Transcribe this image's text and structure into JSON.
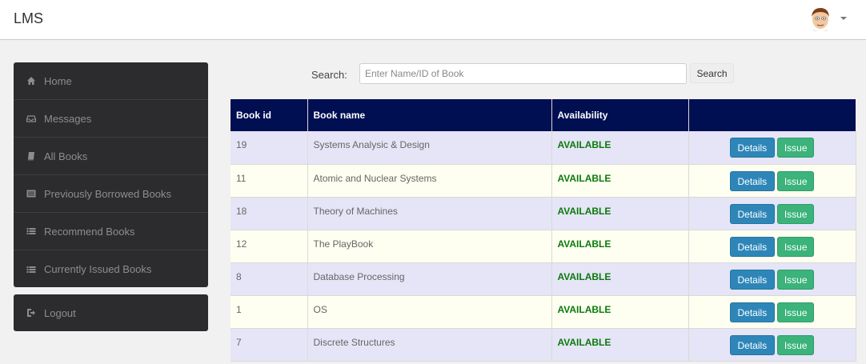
{
  "app": {
    "title": "LMS"
  },
  "sidebar": {
    "items": [
      {
        "label": "Home",
        "icon": "home-icon"
      },
      {
        "label": "Messages",
        "icon": "inbox-icon"
      },
      {
        "label": "All Books",
        "icon": "book-icon"
      },
      {
        "label": "Previously Borrowed Books",
        "icon": "list-alt-icon"
      },
      {
        "label": "Recommend Books",
        "icon": "list-icon"
      },
      {
        "label": "Currently Issued Books",
        "icon": "list-icon"
      }
    ],
    "logout": {
      "label": "Logout",
      "icon": "logout-icon"
    }
  },
  "search": {
    "label": "Search:",
    "placeholder": "Enter Name/ID of Book",
    "value": "",
    "button": "Search"
  },
  "table": {
    "headers": [
      "Book id",
      "Book name",
      "Availability",
      ""
    ],
    "rows": [
      {
        "id": "19",
        "name": "Systems Analysic & Design",
        "availability": "AVAILABLE"
      },
      {
        "id": "11",
        "name": "Atomic and Nuclear Systems",
        "availability": "AVAILABLE"
      },
      {
        "id": "18",
        "name": "Theory of Machines",
        "availability": "AVAILABLE"
      },
      {
        "id": "12",
        "name": "The PlayBook",
        "availability": "AVAILABLE"
      },
      {
        "id": "8",
        "name": "Database Processing",
        "availability": "AVAILABLE"
      },
      {
        "id": "1",
        "name": "OS",
        "availability": "AVAILABLE"
      },
      {
        "id": "7",
        "name": "Discrete Structures",
        "availability": "AVAILABLE"
      }
    ],
    "details_label": "Details",
    "issue_label": "Issue"
  },
  "colors": {
    "header_bg": "#000e52",
    "sidebar_bg": "#2c2c2e",
    "available": "#0a7a0a",
    "details_btn": "#2e86b8",
    "issue_btn": "#3bb37a"
  }
}
